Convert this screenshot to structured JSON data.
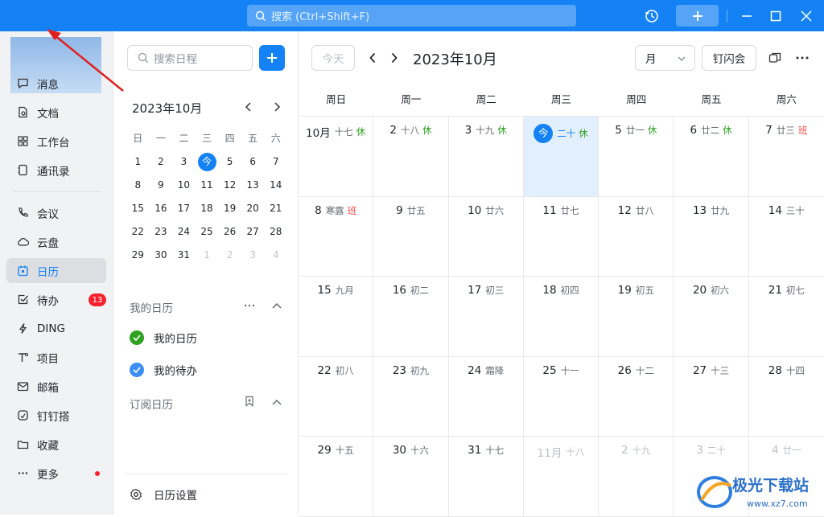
{
  "topbar": {
    "search_placeholder": "搜索 (Ctrl+Shift+F)",
    "accent": "#1482f5"
  },
  "nav": {
    "items": [
      {
        "label": "消息",
        "icon": "message-icon"
      },
      {
        "label": "文档",
        "icon": "doc-icon"
      },
      {
        "label": "工作台",
        "icon": "grid-icon"
      },
      {
        "label": "通讯录",
        "icon": "contacts-icon"
      },
      {
        "label": "会议",
        "icon": "phone-icon"
      },
      {
        "label": "云盘",
        "icon": "cloud-icon"
      },
      {
        "label": "日历",
        "icon": "calendar-icon"
      },
      {
        "label": "待办",
        "icon": "todo-icon"
      },
      {
        "label": "DING",
        "icon": "bolt-icon"
      },
      {
        "label": "项目",
        "icon": "project-icon"
      },
      {
        "label": "邮箱",
        "icon": "mail-icon"
      },
      {
        "label": "钉钉搭",
        "icon": "build-icon"
      },
      {
        "label": "收藏",
        "icon": "folder-icon"
      },
      {
        "label": "更多",
        "icon": "more-icon"
      }
    ],
    "todo_badge": "13"
  },
  "sidebar": {
    "search_placeholder": "搜索日程",
    "mini_title": "2023年10月",
    "weekdays": [
      "日",
      "一",
      "二",
      "三",
      "四",
      "五",
      "六"
    ],
    "today_label": "今",
    "weeks": [
      [
        "1",
        "2",
        "3",
        "今",
        "5",
        "6",
        "7"
      ],
      [
        "8",
        "9",
        "10",
        "11",
        "12",
        "13",
        "14"
      ],
      [
        "15",
        "16",
        "17",
        "18",
        "19",
        "20",
        "21"
      ],
      [
        "22",
        "23",
        "24",
        "25",
        "26",
        "27",
        "28"
      ],
      [
        "29",
        "30",
        "31",
        "1",
        "2",
        "3",
        "4"
      ]
    ],
    "my_calendars_title": "我的日历",
    "calendars": [
      {
        "label": "我的日历",
        "color": "#2ea121"
      },
      {
        "label": "我的待办",
        "color": "#3c8ef5"
      }
    ],
    "subscribed_title": "订阅日历",
    "settings_label": "日历设置"
  },
  "main": {
    "today_button": "今天",
    "month_title": "2023年10月",
    "view_select": "月",
    "flash_meeting": "钉闪会",
    "week_header": [
      "周日",
      "周一",
      "周二",
      "周三",
      "周四",
      "周五",
      "周六"
    ],
    "rows": [
      [
        {
          "day": "10月",
          "lunar": "十七",
          "tag": "休",
          "tag_type": "rest"
        },
        {
          "day": "2",
          "lunar": "十八",
          "tag": "休",
          "tag_type": "rest"
        },
        {
          "day": "3",
          "lunar": "十九",
          "tag": "休",
          "tag_type": "rest"
        },
        {
          "day": "今",
          "lunar": "二十",
          "tag": "休",
          "tag_type": "rest",
          "today": true
        },
        {
          "day": "5",
          "lunar": "廿一",
          "tag": "休",
          "tag_type": "rest"
        },
        {
          "day": "6",
          "lunar": "廿二",
          "tag": "休",
          "tag_type": "rest"
        },
        {
          "day": "7",
          "lunar": "廿三",
          "tag": "班",
          "tag_type": "work"
        }
      ],
      [
        {
          "day": "8",
          "lunar": "寒露",
          "tag": "班",
          "tag_type": "work"
        },
        {
          "day": "9",
          "lunar": "廿五"
        },
        {
          "day": "10",
          "lunar": "廿六"
        },
        {
          "day": "11",
          "lunar": "廿七"
        },
        {
          "day": "12",
          "lunar": "廿八"
        },
        {
          "day": "13",
          "lunar": "廿九"
        },
        {
          "day": "14",
          "lunar": "三十"
        }
      ],
      [
        {
          "day": "15",
          "lunar": "九月"
        },
        {
          "day": "16",
          "lunar": "初二"
        },
        {
          "day": "17",
          "lunar": "初三"
        },
        {
          "day": "18",
          "lunar": "初四"
        },
        {
          "day": "19",
          "lunar": "初五"
        },
        {
          "day": "20",
          "lunar": "初六"
        },
        {
          "day": "21",
          "lunar": "初七"
        }
      ],
      [
        {
          "day": "22",
          "lunar": "初八"
        },
        {
          "day": "23",
          "lunar": "初九"
        },
        {
          "day": "24",
          "lunar": "霜降"
        },
        {
          "day": "25",
          "lunar": "十一"
        },
        {
          "day": "26",
          "lunar": "十二"
        },
        {
          "day": "27",
          "lunar": "十三"
        },
        {
          "day": "28",
          "lunar": "十四"
        }
      ],
      [
        {
          "day": "29",
          "lunar": "十五"
        },
        {
          "day": "30",
          "lunar": "十六"
        },
        {
          "day": "31",
          "lunar": "十七"
        },
        {
          "day": "11月",
          "lunar": "十八",
          "dim": true
        },
        {
          "day": "2",
          "lunar": "十九",
          "dim": true
        },
        {
          "day": "3",
          "lunar": "二十",
          "dim": true
        },
        {
          "day": "4",
          "lunar": "廿一",
          "dim": true
        }
      ]
    ]
  },
  "watermark": {
    "text": "极光下载站",
    "url": "www.xz7.com"
  }
}
